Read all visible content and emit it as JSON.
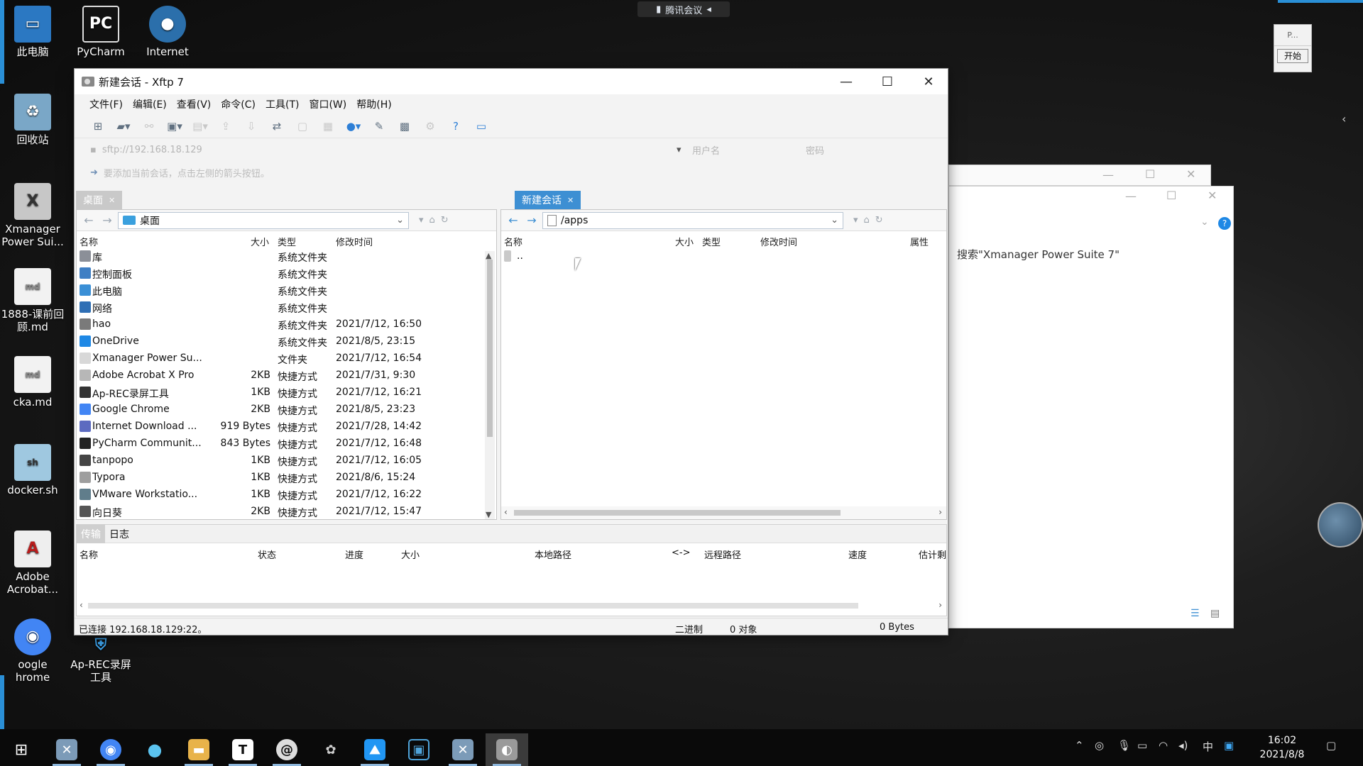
{
  "desktop": {
    "meeting_label": "腾讯会议",
    "icons": [
      {
        "label": "此电脑",
        "name": "this-pc"
      },
      {
        "label": "PyCharm",
        "name": "pycharm"
      },
      {
        "label": "Internet",
        "name": "internet"
      },
      {
        "label": "回收站",
        "name": "recycle-bin"
      },
      {
        "label": "Xmanager Power Sui...",
        "name": "xmanager"
      },
      {
        "label": "1888-课前回顾.md",
        "name": "md-file-1888"
      },
      {
        "label": "cka.md",
        "name": "cka-md"
      },
      {
        "label": "docker.sh",
        "name": "docker-sh"
      },
      {
        "label": "Adobe Acrobat...",
        "name": "adobe-acrobat"
      },
      {
        "label": "oogle hrome",
        "name": "google-chrome"
      },
      {
        "label": "Ap-REC录屏工具",
        "name": "ap-rec"
      }
    ],
    "side_panel": {
      "top": "P...",
      "button": "开始"
    }
  },
  "bg_window": {
    "search_text": "搜索\"Xmanager Power Suite 7\""
  },
  "xftp": {
    "title": "新建会话 - Xftp 7",
    "menu": [
      "文件(F)",
      "编辑(E)",
      "查看(V)",
      "命令(C)",
      "工具(T)",
      "窗口(W)",
      "帮助(H)"
    ],
    "address_placeholder": "sftp://192.168.18.129",
    "username_placeholder": "用户名",
    "password_placeholder": "密码",
    "hint": "要添加当前会话，点击左侧的箭头按钮。",
    "left_tab": "桌面",
    "right_tab": "新建会话",
    "left_path": "桌面",
    "right_path": "/apps",
    "left_columns": {
      "name": "名称",
      "size": "大小",
      "type": "类型",
      "mtime": "修改时间"
    },
    "right_columns": {
      "name": "名称",
      "size": "大小",
      "type": "类型",
      "mtime": "修改时间",
      "attr": "属性"
    },
    "left_files": [
      {
        "name": "库",
        "size": "",
        "type": "系统文件夹",
        "mtime": "",
        "color": "#8b8f98"
      },
      {
        "name": "控制面板",
        "size": "",
        "type": "系统文件夹",
        "mtime": "",
        "color": "#3f7fc4"
      },
      {
        "name": "此电脑",
        "size": "",
        "type": "系统文件夹",
        "mtime": "",
        "color": "#3a8fd6"
      },
      {
        "name": "网络",
        "size": "",
        "type": "系统文件夹",
        "mtime": "",
        "color": "#2f6fb5"
      },
      {
        "name": "hao",
        "size": "",
        "type": "系统文件夹",
        "mtime": "2021/7/12, 16:50",
        "color": "#7a7a7a"
      },
      {
        "name": "OneDrive",
        "size": "",
        "type": "系统文件夹",
        "mtime": "2021/8/5, 23:15",
        "color": "#1e88e5"
      },
      {
        "name": "Xmanager Power Su...",
        "size": "",
        "type": "文件夹",
        "mtime": "2021/7/12, 16:54",
        "color": "#d8d8d8"
      },
      {
        "name": "Adobe Acrobat X Pro",
        "size": "2KB",
        "type": "快捷方式",
        "mtime": "2021/7/31, 9:30",
        "color": "#b7b7b7"
      },
      {
        "name": "Ap-REC录屏工具",
        "size": "1KB",
        "type": "快捷方式",
        "mtime": "2021/7/12, 16:21",
        "color": "#333333"
      },
      {
        "name": "Google Chrome",
        "size": "2KB",
        "type": "快捷方式",
        "mtime": "2021/8/5, 23:23",
        "color": "#4285f4"
      },
      {
        "name": "Internet Download ...",
        "size": "919 Bytes",
        "type": "快捷方式",
        "mtime": "2021/7/28, 14:42",
        "color": "#5c6bc0"
      },
      {
        "name": "PyCharm Communit...",
        "size": "843 Bytes",
        "type": "快捷方式",
        "mtime": "2021/7/12, 16:48",
        "color": "#222222"
      },
      {
        "name": "tanpopo",
        "size": "1KB",
        "type": "快捷方式",
        "mtime": "2021/7/12, 16:05",
        "color": "#444444"
      },
      {
        "name": "Typora",
        "size": "1KB",
        "type": "快捷方式",
        "mtime": "2021/8/6, 15:24",
        "color": "#9e9e9e"
      },
      {
        "name": "VMware Workstatio...",
        "size": "1KB",
        "type": "快捷方式",
        "mtime": "2021/7/12, 16:22",
        "color": "#607d8b"
      },
      {
        "name": "向日葵",
        "size": "2KB",
        "type": "快捷方式",
        "mtime": "2021/7/12, 15:47",
        "color": "#555555"
      }
    ],
    "right_files": [
      {
        "name": ".."
      }
    ],
    "transfer_tabs": [
      "传输",
      "日志"
    ],
    "transfer_columns": {
      "name": "名称",
      "status": "状态",
      "progress": "进度",
      "size": "大小",
      "local": "本地路径",
      "arrow": "<->",
      "remote": "远程路径",
      "speed": "速度",
      "eta": "估计剩"
    },
    "status": {
      "connected": "已连接 192.168.18.129:22。",
      "mode": "二进制",
      "objects": "0 对象",
      "bytes": "0 Bytes"
    }
  },
  "taskbar": {
    "time": "16:02",
    "date": "2021/8/8",
    "ime": "中"
  }
}
